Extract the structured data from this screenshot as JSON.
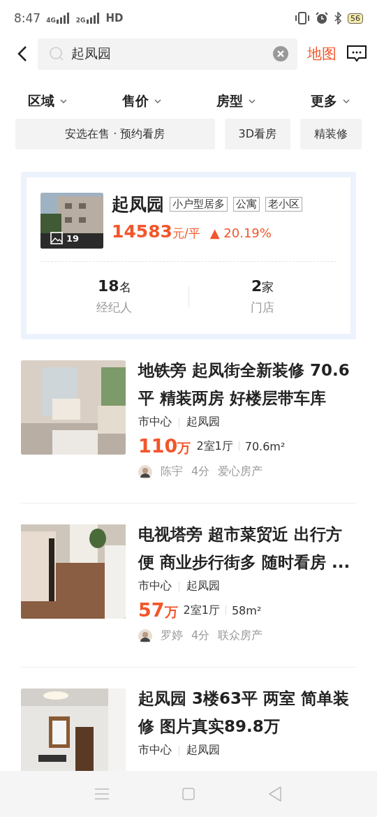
{
  "status_bar": {
    "time": "8:47",
    "networks": [
      "4G",
      "2G"
    ],
    "hd": "HD",
    "battery": "56"
  },
  "header": {
    "search": {
      "value": "起凤园"
    },
    "map_link": "地图"
  },
  "filters": [
    {
      "label": "区域"
    },
    {
      "label": "售价"
    },
    {
      "label": "房型"
    },
    {
      "label": "更多"
    }
  ],
  "chips": [
    "安选在售 · 预约看房",
    "3D看房",
    "精装修"
  ],
  "community": {
    "name": "起凤园",
    "tags": [
      "小户型居多",
      "公寓",
      "老小区"
    ],
    "photo_count": "19",
    "price": "14583",
    "price_unit": "元/平",
    "change": "▲ 20.19%",
    "stats": [
      {
        "value": "18",
        "unit": "名",
        "label": "经纪人"
      },
      {
        "value": "2",
        "unit": "家",
        "label": "门店"
      }
    ]
  },
  "listings": [
    {
      "title": "地铁旁 起凤街全新装修 70.6平 精装两房 好楼层带车库",
      "district": "市中心",
      "community": "起凤园",
      "price": "110",
      "price_unit": "万",
      "layout": "2室1厅",
      "area": "70.6m²",
      "agent": "陈宇",
      "score": "4分",
      "agency": "爱心房产"
    },
    {
      "title": "电视塔旁 超市菜贸近 出行方便 商业步行街多 随时看房 ...",
      "district": "市中心",
      "community": "起凤园",
      "price": "57",
      "price_unit": "万",
      "layout": "2室1厅",
      "area": "58m²",
      "agent": "罗婷",
      "score": "4分",
      "agency": "联众房产"
    },
    {
      "title": "起凤园 3楼63平 两室 简单装修 图片真实89.8万",
      "district": "市中心",
      "community": "起凤园"
    }
  ]
}
